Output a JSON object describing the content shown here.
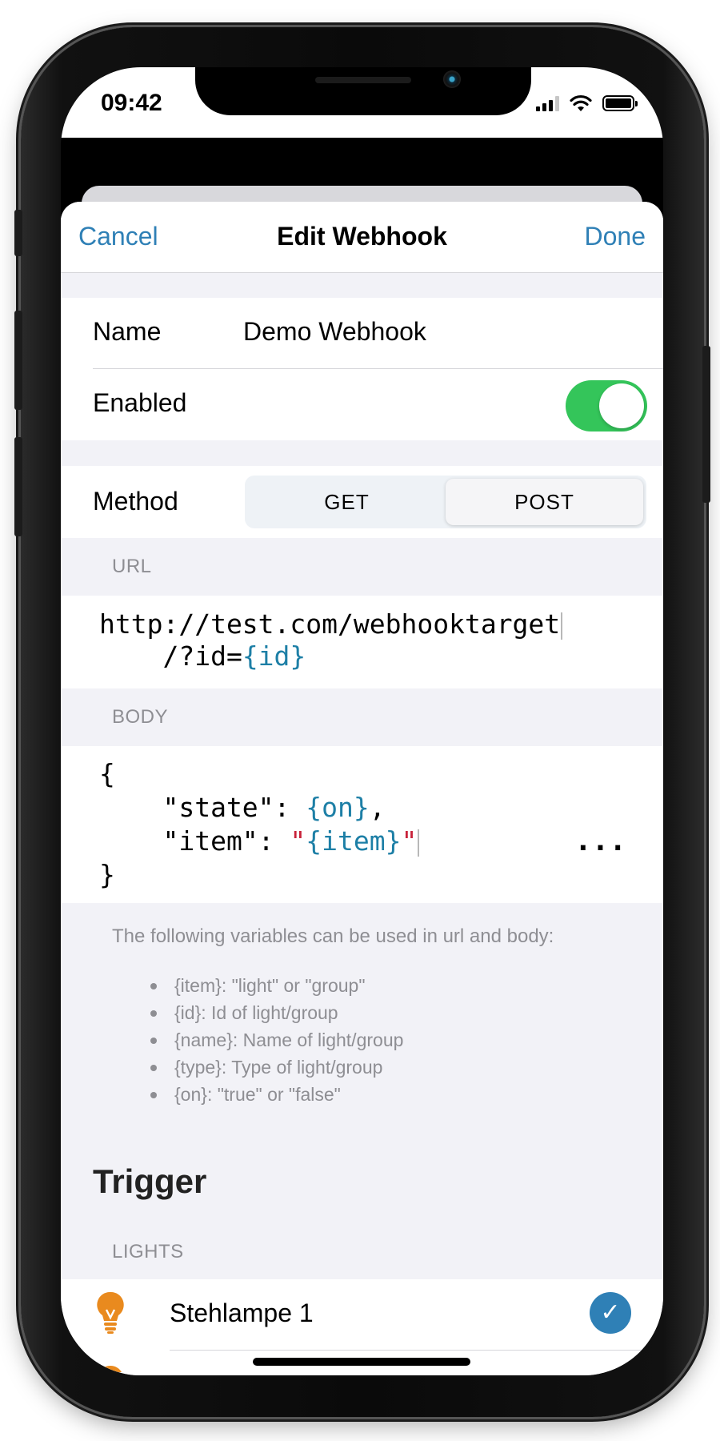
{
  "status_bar": {
    "time": "09:42"
  },
  "nav": {
    "cancel": "Cancel",
    "title": "Edit Webhook",
    "done": "Done"
  },
  "form": {
    "name_label": "Name",
    "name_value": "Demo Webhook",
    "enabled_label": "Enabled",
    "enabled": true,
    "method_label": "Method",
    "method_options": [
      "GET",
      "POST"
    ],
    "method_selected": "POST"
  },
  "url": {
    "header": "URL",
    "line1": "http://test.com/webhooktarget",
    "line2_prefix": "    /?id=",
    "line2_var": "{id}"
  },
  "body": {
    "header": "BODY",
    "line1": "{",
    "line2_key": "    \"state\": ",
    "line2_var": "{on}",
    "line2_end": ",",
    "line3_key": "    \"item\": ",
    "line3_q1": "\"",
    "line3_var": "{item}",
    "line3_q2": "\"",
    "line4": "}",
    "more": "..."
  },
  "variables": {
    "intro": "The following variables can be used in url and body:",
    "items": [
      "{item}: \"light\" or \"group\"",
      "{id}: Id of light/group",
      "{name}: Name of light/group",
      "{type}: Type of light/group",
      "{on}: \"true\" or \"false\""
    ]
  },
  "trigger": {
    "title": "Trigger",
    "lights_header": "LIGHTS",
    "lights": [
      {
        "name": "Stehlampe 1",
        "checked": true
      }
    ]
  },
  "colors": {
    "accent": "#2f80b6",
    "toggle_on": "#34c55a",
    "variable": "#1d7fa6",
    "string": "#c8223a",
    "bulb": "#e98a1e"
  },
  "icons": {
    "signal": "cellular-signal-icon",
    "wifi": "wifi-icon",
    "battery": "battery-icon",
    "bulb": "lightbulb-icon",
    "check": "checkmark-circle-icon"
  }
}
